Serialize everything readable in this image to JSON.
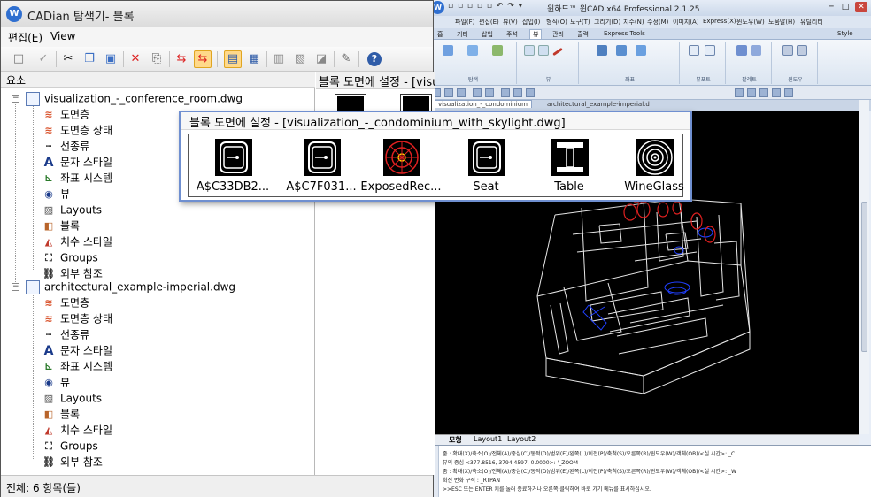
{
  "explorer": {
    "title": "CADian 탐색기- 블록",
    "menu": [
      "편집(E)",
      "View"
    ],
    "tree_header": "요소",
    "preview_header": "블록 도면에 설정 - [visu",
    "status": "전체: 6 항목(들)",
    "files": [
      {
        "name": "visualization_-_conference_room.dwg",
        "children": [
          "도면층",
          "도면층 상태",
          "선종류",
          "문자 스타일",
          "좌표 시스템",
          "뷰",
          "Layouts",
          "블록",
          "치수 스타일",
          "Groups",
          "외부 참조"
        ]
      },
      {
        "name": "architectural_example-imperial.dwg",
        "children": [
          "도면층",
          "도면층 상태",
          "선종류",
          "문자 스타일",
          "좌표 시스템",
          "뷰",
          "Layouts",
          "블록",
          "치수 스타일",
          "Groups",
          "외부 참조"
        ]
      }
    ],
    "child_icons": [
      "layers-icon",
      "layer-state-icon",
      "linetype-icon",
      "text-style-icon",
      "ucs-icon",
      "view-icon",
      "layouts-icon",
      "block-icon",
      "dimstyle-icon",
      "groups-icon",
      "xref-icon"
    ]
  },
  "popup": {
    "title": "블록 도면에 설정 - [visualization_-_condominium_with_skylight.dwg]",
    "blocks": [
      {
        "name": "A$C33DB2...",
        "icon": "plug-block-icon"
      },
      {
        "name": "A$C7F031...",
        "icon": "plug-block-icon"
      },
      {
        "name": "ExposedRec...",
        "icon": "exposed-recessed-light-icon"
      },
      {
        "name": "Seat",
        "icon": "seat-block-icon"
      },
      {
        "name": "Table",
        "icon": "table-block-icon"
      },
      {
        "name": "WineGlass",
        "icon": "wineglass-block-icon"
      }
    ]
  },
  "cad": {
    "title": "윈하드™ 윈CAD x64 Professional 2.1.25",
    "style_label": "Style",
    "menu": [
      "파일(F)",
      "편집(E)",
      "뷰(V)",
      "삽입(I)",
      "형식(O)",
      "도구(T)",
      "그리기(D)",
      "치수(N)",
      "수정(M)",
      "이미지(A)",
      "Express(X)",
      "윈도우(W)",
      "도움말(H)",
      "유틸리티"
    ],
    "ribbon_tabs": [
      "홈",
      "기타",
      "삽입",
      "주석",
      "뷰",
      "관리",
      "출력",
      "Express Tools"
    ],
    "active_ribbon_tab": "뷰",
    "ribbon_groups": [
      "탐색",
      "뷰",
      "좌표",
      "뷰포트",
      "팔레트",
      "윈도우"
    ],
    "ribbon_buttons": [
      "실시간 초점 이동",
      "윈도우 줌",
      "실시간 주 회전",
      "다시 그리기(R)",
      "표준"
    ],
    "doc_tabs": [
      "visualization_-_condominium",
      "architectural_example-imperial.d"
    ],
    "layout_tabs": [
      "모형",
      "Layout1",
      "Layout2"
    ],
    "cmd_gutter": "명 령",
    "cmd_lines": [
      "줌 : 확대(X)/축소(O)/전체(A)/중심(C)/동적(D)/범위(E)/왼쪽(L)/이전(P)/축척(S)/오른쪽(R)/윈도우(W)/객체(OB)/<실 시간>: _C",
      "뷰의 중심 <377.8516, 3794.4597, 0.0000>: '_ZOOM",
      "줌 : 확대(X)/축소(O)/전체(A)/중심(C)/동적(D)/범위(E)/왼쪽(L)/이전(P)/축척(S)/오른쪽(R)/윈도우(W)/객체(OB)/<실 시간>: _W",
      "회전 변화 구석 : _RTPAN",
      ">>ESC 또는 ENTER 키를 눌러 종료하거나 오른쪽 클릭하여 바로 가기 메뉴를 표시하십시오."
    ]
  },
  "colors": {
    "accent": "#6f8fd0",
    "wire": "#e6e6e6",
    "red_block": "#e02020",
    "blue_block": "#2040ff"
  }
}
